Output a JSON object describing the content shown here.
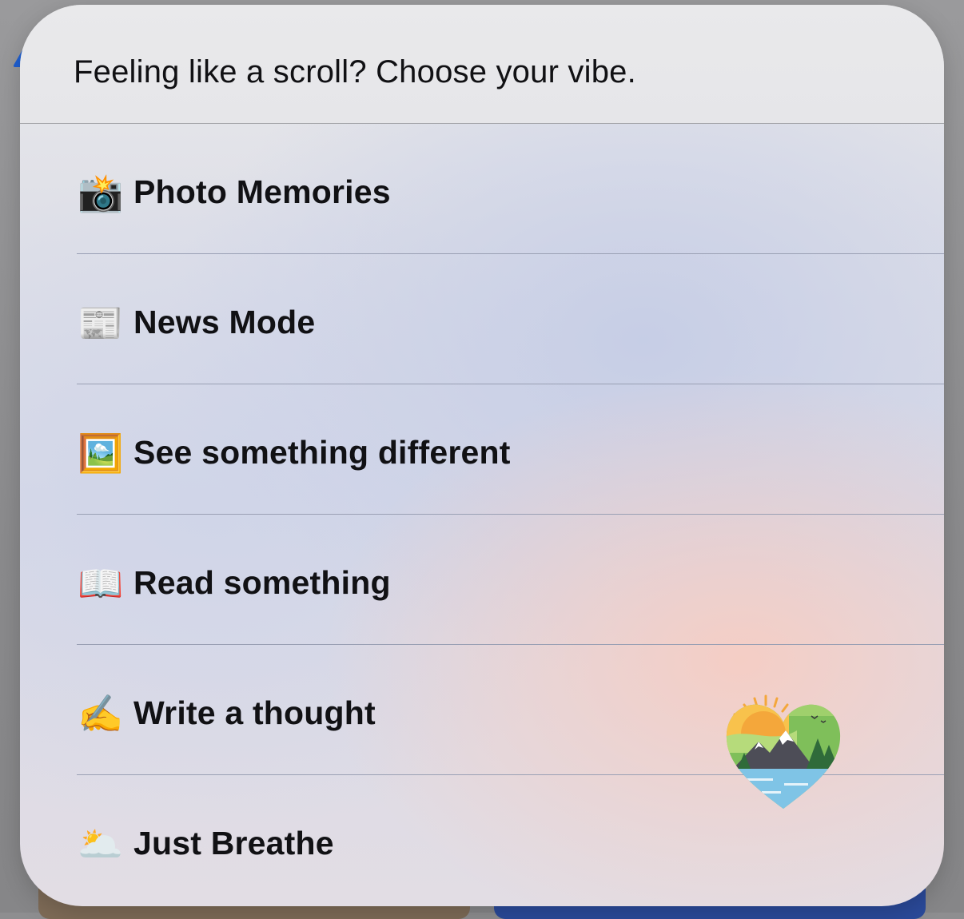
{
  "sheet": {
    "title": "Feeling like a scroll? Choose your vibe."
  },
  "menu": {
    "items": [
      {
        "icon": "camera-flash-icon",
        "glyph": "📸",
        "label": "Photo Memories"
      },
      {
        "icon": "newspaper-icon",
        "glyph": "📰",
        "label": "News Mode"
      },
      {
        "icon": "framed-picture-icon",
        "glyph": "🖼️",
        "label": "See something different"
      },
      {
        "icon": "open-book-icon",
        "glyph": "📖",
        "label": "Read something"
      },
      {
        "icon": "writing-hand-icon",
        "glyph": "✍️",
        "label": "Write a thought"
      },
      {
        "icon": "sun-behind-cloud-icon",
        "glyph": "🌥️",
        "label": "Just Breathe"
      }
    ]
  },
  "colors": {
    "text": "#111114",
    "divider": "#9aa0b4",
    "heart_sun": "#f4a73b",
    "heart_green": "#7fbf5a",
    "heart_water": "#7fc4e6"
  }
}
